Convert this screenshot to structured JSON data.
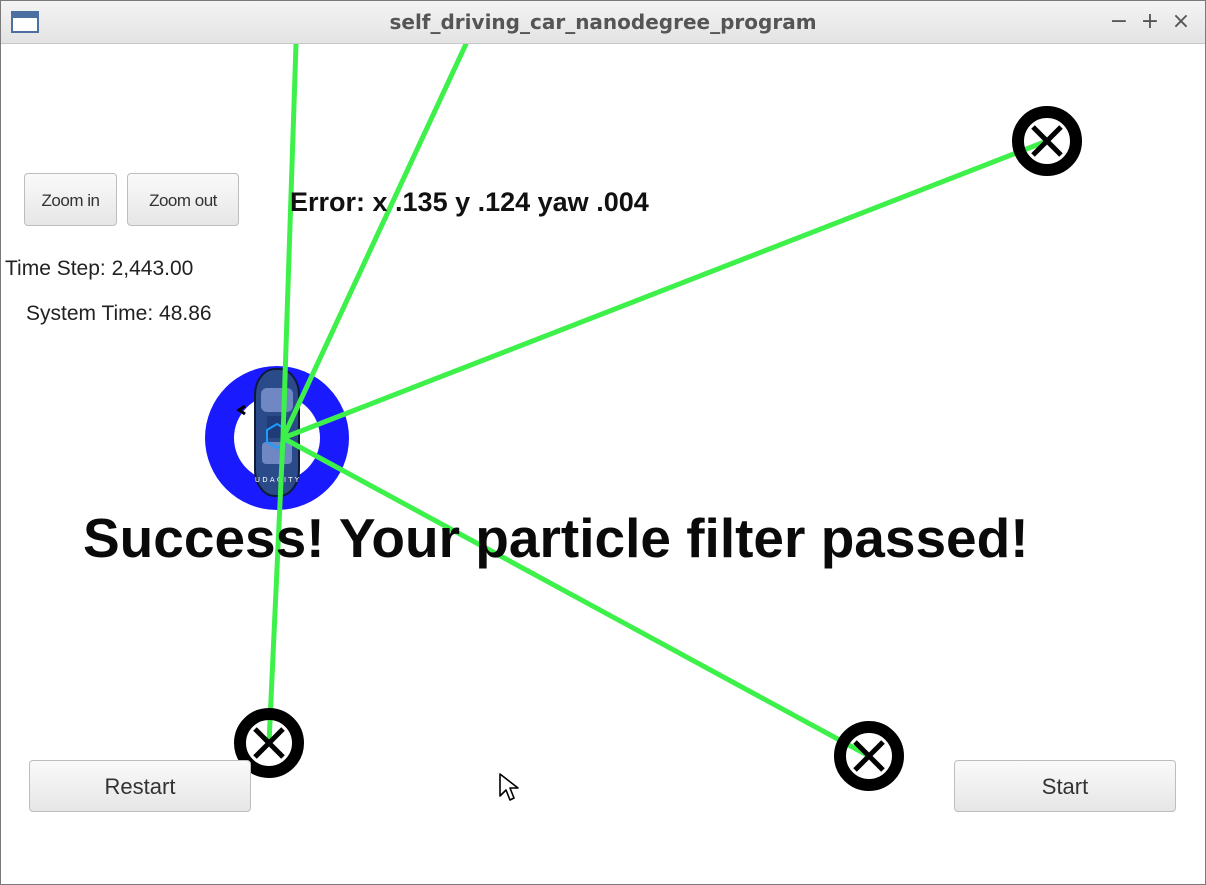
{
  "window": {
    "title": "self_driving_car_nanodegree_program",
    "minimize": "−",
    "maximize": "+",
    "close": "×"
  },
  "toolbar": {
    "zoom_in_label": "Zoom in",
    "zoom_out_label": "Zoom out"
  },
  "status": {
    "time_step": "Time Step: 2,443.00",
    "system_time": "System Time: 48.86"
  },
  "error_readout": "Error: x .135 y .124 yaw .004",
  "result_message": "Success! Your particle filter passed!",
  "controls": {
    "restart_label": "Restart",
    "start_label": "Start"
  },
  "colors": {
    "observation_line": "#3ef04a",
    "particle_ring": "#1a1aff",
    "landmark": "#000000"
  },
  "scene_icons": [
    "car-icon",
    "landmark-marker-icon",
    "observation-line",
    "mouse-pointer-icon"
  ]
}
